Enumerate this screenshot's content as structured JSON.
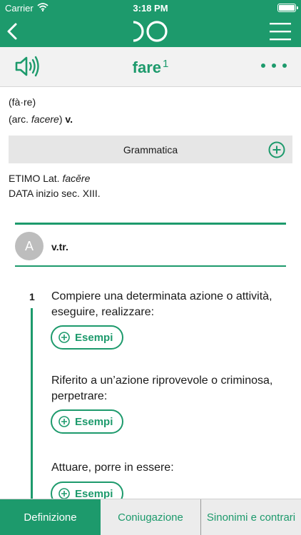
{
  "status_bar": {
    "carrier": "Carrier",
    "time": "3:18 PM"
  },
  "header": {
    "back_icon": "chevron-left-icon",
    "logo_icon": "dictionary-logo-icon",
    "menu_icon": "hamburger-menu-icon"
  },
  "word": {
    "headword": "fare",
    "homograph": "1",
    "audio_icon": "speaker-icon",
    "more_icon": "more-dots-icon"
  },
  "entry": {
    "syllabification": "(fà·re)",
    "archaic_prefix": "(arc. ",
    "archaic_form": "facere",
    "archaic_suffix": ")",
    "pos_abbr": "v.",
    "grammar_label": "Grammatica",
    "etymology_prefix": "ETIMO Lat. ",
    "etymology_word": "facĕre",
    "date": "DATA inizio sec. XIII."
  },
  "section": {
    "letter": "A",
    "label": "v.tr."
  },
  "meaning": {
    "number": "1",
    "definitions": [
      {
        "text": "Compiere una determinata azione o attività, eseguire, realizzare:",
        "button": "Esempi"
      },
      {
        "text": "Riferito a un’azione riprovevole o criminosa, perpetrare:",
        "button": "Esempi"
      },
      {
        "text": "Attuare, porre in essere:",
        "button": "Esempi"
      }
    ]
  },
  "tabs": [
    {
      "label": "Definizione",
      "active": true
    },
    {
      "label": "Coniugazione",
      "active": false
    },
    {
      "label": "Sinonimi e contrari",
      "active": false
    }
  ],
  "colors": {
    "accent": "#1d9a6c",
    "bar": "#f2f2f2",
    "grammar_bg": "#e6e6e6",
    "avatar": "#bdbdbd"
  }
}
